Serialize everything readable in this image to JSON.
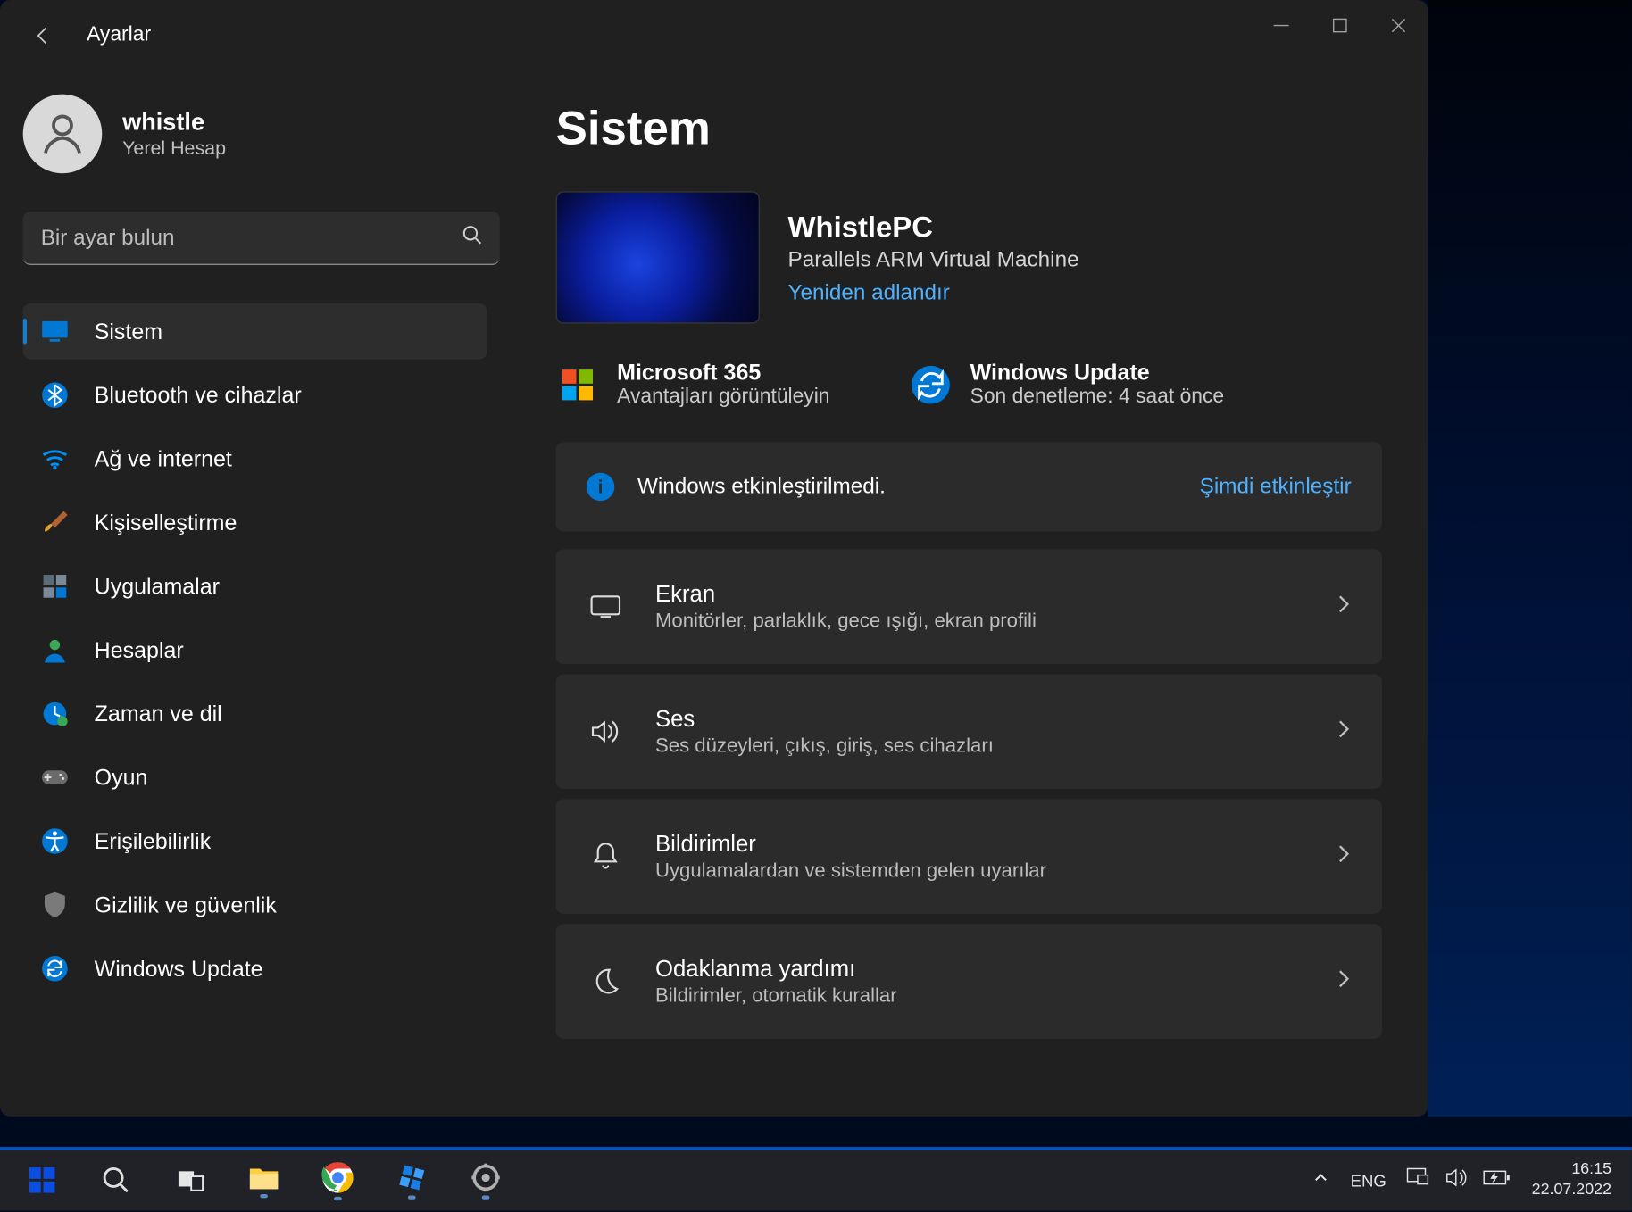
{
  "window": {
    "title": "Ayarlar"
  },
  "profile": {
    "name": "whistle",
    "subtitle": "Yerel Hesap"
  },
  "search": {
    "placeholder": "Bir ayar bulun"
  },
  "nav": [
    {
      "label": "Sistem",
      "icon": "monitor",
      "selected": true
    },
    {
      "label": "Bluetooth ve cihazlar",
      "icon": "bluetooth"
    },
    {
      "label": "Ağ ve internet",
      "icon": "wifi"
    },
    {
      "label": "Kişiselleştirme",
      "icon": "brush"
    },
    {
      "label": "Uygulamalar",
      "icon": "apps"
    },
    {
      "label": "Hesaplar",
      "icon": "person"
    },
    {
      "label": "Zaman ve dil",
      "icon": "clock-globe"
    },
    {
      "label": "Oyun",
      "icon": "gamepad"
    },
    {
      "label": "Erişilebilirlik",
      "icon": "accessibility"
    },
    {
      "label": "Gizlilik ve güvenlik",
      "icon": "shield"
    },
    {
      "label": "Windows Update",
      "icon": "sync"
    }
  ],
  "main": {
    "heading": "Sistem",
    "pc": {
      "name": "WhistlePC",
      "desc": "Parallels ARM Virtual Machine",
      "rename": "Yeniden adlandır"
    },
    "shortcuts": [
      {
        "title": "Microsoft 365",
        "sub": "Avantajları görüntüleyin",
        "icon": "ms365"
      },
      {
        "title": "Windows Update",
        "sub": "Son denetleme: 4 saat önce",
        "icon": "winupdate"
      }
    ],
    "alert": {
      "text": "Windows etkinleştirilmedi.",
      "link": "Şimdi etkinleştir"
    },
    "items": [
      {
        "title": "Ekran",
        "sub": "Monitörler, parlaklık, gece ışığı, ekran profili",
        "icon": "screen"
      },
      {
        "title": "Ses",
        "sub": "Ses düzeyleri, çıkış, giriş, ses cihazları",
        "icon": "sound"
      },
      {
        "title": "Bildirimler",
        "sub": "Uygulamalardan ve sistemden gelen uyarılar",
        "icon": "bell"
      },
      {
        "title": "Odaklanma yardımı",
        "sub": "Bildirimler, otomatik kurallar",
        "icon": "moon"
      }
    ]
  },
  "taskbar": {
    "lang": "ENG",
    "time": "16:15",
    "date": "22.07.2022"
  }
}
